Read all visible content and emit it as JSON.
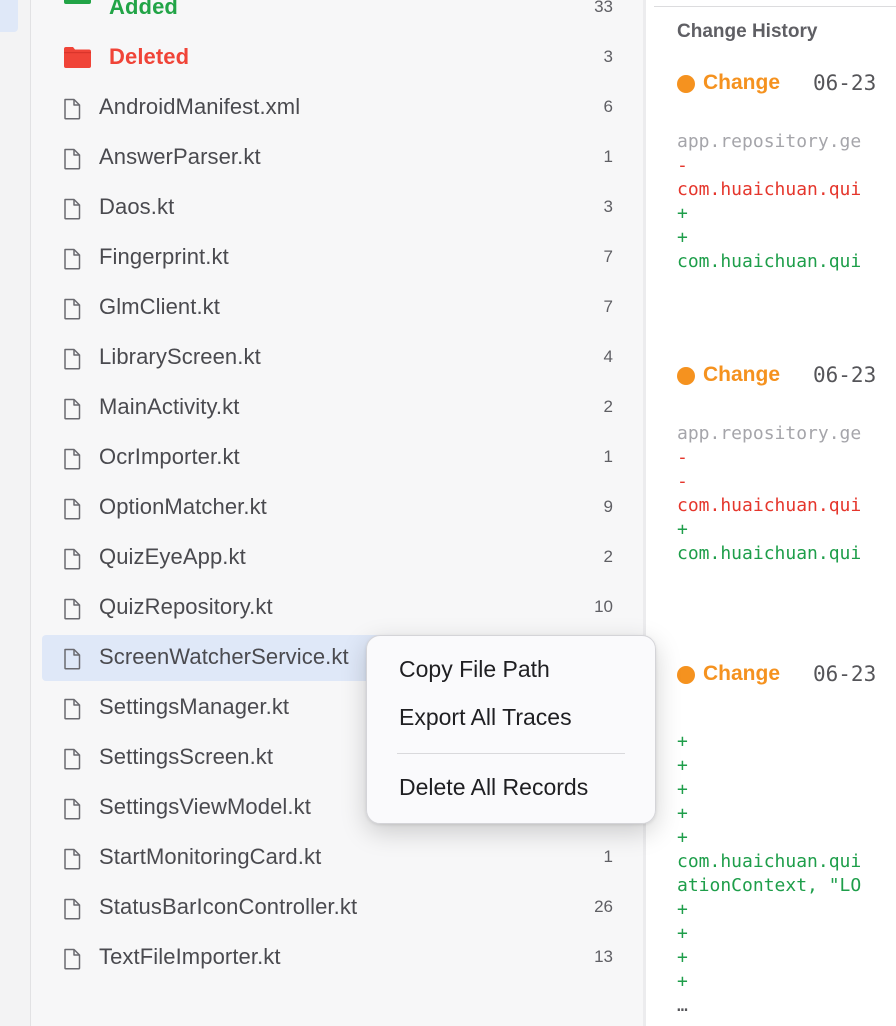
{
  "files": {
    "folders": [
      {
        "name": "Added",
        "count": "33",
        "color": "#22a447",
        "icon": "green-folder-icon"
      },
      {
        "name": "Deleted",
        "count": "3",
        "color": "#f04438",
        "icon": "red-folder-icon"
      }
    ],
    "items": [
      {
        "name": "AndroidManifest.xml",
        "count": "6"
      },
      {
        "name": "AnswerParser.kt",
        "count": "1"
      },
      {
        "name": "Daos.kt",
        "count": "3"
      },
      {
        "name": "Fingerprint.kt",
        "count": "7"
      },
      {
        "name": "GlmClient.kt",
        "count": "7"
      },
      {
        "name": "LibraryScreen.kt",
        "count": "4"
      },
      {
        "name": "MainActivity.kt",
        "count": "2"
      },
      {
        "name": "OcrImporter.kt",
        "count": "1"
      },
      {
        "name": "OptionMatcher.kt",
        "count": "9"
      },
      {
        "name": "QuizEyeApp.kt",
        "count": "2"
      },
      {
        "name": "QuizRepository.kt",
        "count": "10"
      },
      {
        "name": "ScreenWatcherService.kt",
        "count": ""
      },
      {
        "name": "SettingsManager.kt",
        "count": ""
      },
      {
        "name": "SettingsScreen.kt",
        "count": ""
      },
      {
        "name": "SettingsViewModel.kt",
        "count": ""
      },
      {
        "name": "StartMonitoringCard.kt",
        "count": "1"
      },
      {
        "name": "StatusBarIconController.kt",
        "count": "26"
      },
      {
        "name": "TextFileImporter.kt",
        "count": "13"
      }
    ],
    "selected_index": 11
  },
  "history": {
    "title": "Change History",
    "accent": "#f5921f",
    "changes": [
      {
        "label": "Change",
        "date": "06-23",
        "lines": [
          {
            "t": "app.repository.ge",
            "c": "gray"
          },
          {
            "t": "-",
            "c": "red"
          },
          {
            "t": "com.huaichuan.qui",
            "c": "red"
          },
          {
            "t": "+",
            "c": "green"
          },
          {
            "t": "+",
            "c": "green"
          },
          {
            "t": "com.huaichuan.qui",
            "c": "green"
          }
        ]
      },
      {
        "label": "Change",
        "date": "06-23",
        "lines": [
          {
            "t": "app.repository.ge",
            "c": "gray"
          },
          {
            "t": "-",
            "c": "red"
          },
          {
            "t": "-",
            "c": "red"
          },
          {
            "t": "com.huaichuan.qui",
            "c": "red"
          },
          {
            "t": "+",
            "c": "green"
          },
          {
            "t": "com.huaichuan.qui",
            "c": "green"
          }
        ]
      },
      {
        "label": "Change",
        "date": "06-23",
        "lines": [
          {
            "t": "+",
            "c": "green"
          },
          {
            "t": "+",
            "c": "green"
          },
          {
            "t": "+",
            "c": "green"
          },
          {
            "t": "+",
            "c": "green"
          },
          {
            "t": "+",
            "c": "green"
          },
          {
            "t": "com.huaichuan.qui",
            "c": "green"
          },
          {
            "t": "ationContext, \"LO",
            "c": "green"
          },
          {
            "t": "+",
            "c": "green"
          },
          {
            "t": "+",
            "c": "green"
          },
          {
            "t": "+",
            "c": "green"
          },
          {
            "t": "+",
            "c": "green"
          },
          {
            "t": "…",
            "c": "dark"
          }
        ]
      }
    ]
  },
  "context_menu": {
    "items": [
      {
        "label": "Copy File Path"
      },
      {
        "label": "Export All Traces"
      },
      {
        "label": "Delete All Records"
      }
    ]
  }
}
